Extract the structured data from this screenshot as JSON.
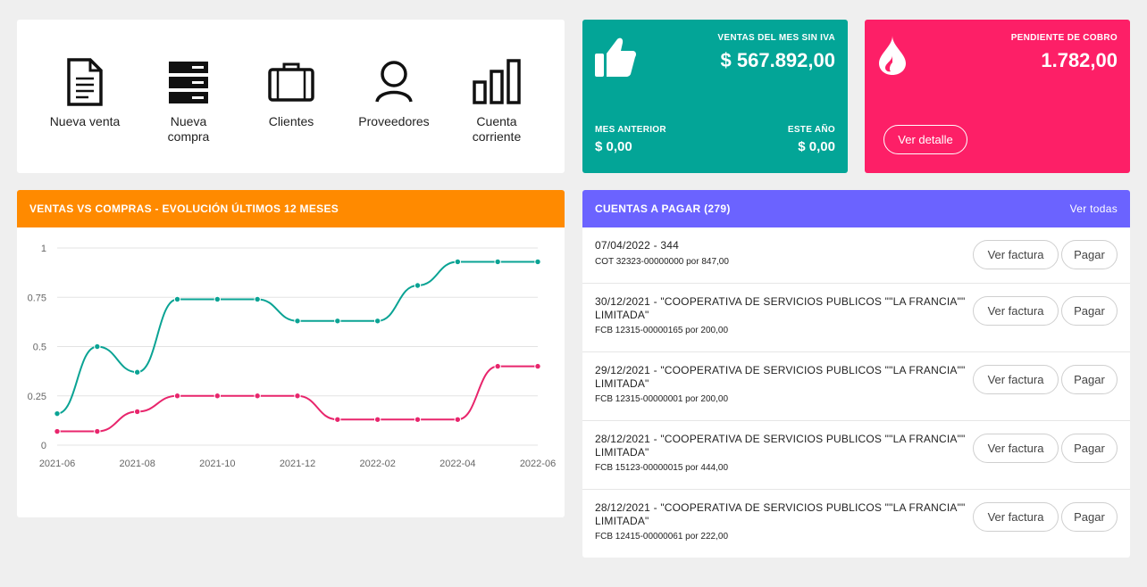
{
  "quick_actions": [
    {
      "label": "Nueva venta",
      "icon": "document-icon"
    },
    {
      "label": "Nueva compra",
      "icon": "stack-icon"
    },
    {
      "label": "Clientes",
      "icon": "briefcase-icon"
    },
    {
      "label": "Proveedores",
      "icon": "user-icon"
    },
    {
      "label": "Cuenta corriente",
      "icon": "bar-chart-icon"
    }
  ],
  "sales_card": {
    "title": "VENTAS DEL MES SIN IVA",
    "value": "$ 567.892,00",
    "prev_label": "MES ANTERIOR",
    "prev_value": "$ 0,00",
    "year_label": "ESTE AÑO",
    "year_value": "$ 0,00",
    "icon": "thumbs-up-icon",
    "color": "#03a597"
  },
  "pending_card": {
    "title": "PENDIENTE DE COBRO",
    "value": "1.782,00",
    "button": "Ver detalle",
    "icon": "droplet-icon",
    "color": "#fd1f67"
  },
  "chart_panel": {
    "title": "VENTAS VS COMPRAS - EVOLUCIÓN ÚLTIMOS 12 MESES",
    "color": "#ff8a00"
  },
  "chart_data": {
    "type": "line",
    "x": [
      "2021-06",
      "2021-07",
      "2021-08",
      "2021-09",
      "2021-10",
      "2021-11",
      "2021-12",
      "2022-01",
      "2022-02",
      "2022-03",
      "2022-04",
      "2022-05",
      "2022-06"
    ],
    "xticks": [
      "2021-06",
      "2021-08",
      "2021-10",
      "2021-12",
      "2022-02",
      "2022-04",
      "2022-06"
    ],
    "yticks": [
      "0",
      "0.25",
      "0.5",
      "0.75",
      "1"
    ],
    "ylim": [
      0,
      1
    ],
    "grid": true,
    "series": [
      {
        "color": "#0aa394",
        "values": [
          0.16,
          0.5,
          0.37,
          0.74,
          0.74,
          0.74,
          0.63,
          0.63,
          0.63,
          0.81,
          0.93,
          0.93,
          0.93
        ]
      },
      {
        "color": "#e8256c",
        "values": [
          0.07,
          0.07,
          0.17,
          0.25,
          0.25,
          0.25,
          0.25,
          0.13,
          0.13,
          0.13,
          0.13,
          0.4,
          0.4
        ]
      }
    ]
  },
  "accounts": {
    "title": "CUENTAS A PAGAR (279)",
    "see_all": "Ver todas",
    "color": "#6b63ff",
    "view_label": "Ver factura",
    "pay_label": "Pagar",
    "items": [
      {
        "title": "07/04/2022 - 344",
        "sub": "COT 32323-00000000 por 847,00"
      },
      {
        "title": "30/12/2021 - \"COOPERATIVA DE SERVICIOS PUBLICOS \"\"LA FRANCIA\"\" LIMITADA\"",
        "sub": "FCB 12315-00000165 por 200,00"
      },
      {
        "title": "29/12/2021 - \"COOPERATIVA DE SERVICIOS PUBLICOS \"\"LA FRANCIA\"\" LIMITADA\"",
        "sub": "FCB 12315-00000001 por 200,00"
      },
      {
        "title": "28/12/2021 - \"COOPERATIVA DE SERVICIOS PUBLICOS \"\"LA FRANCIA\"\" LIMITADA\"",
        "sub": "FCB 15123-00000015 por 444,00"
      },
      {
        "title": "28/12/2021 - \"COOPERATIVA DE SERVICIOS PUBLICOS \"\"LA FRANCIA\"\" LIMITADA\"",
        "sub": "FCB 12415-00000061 por 222,00"
      }
    ]
  }
}
